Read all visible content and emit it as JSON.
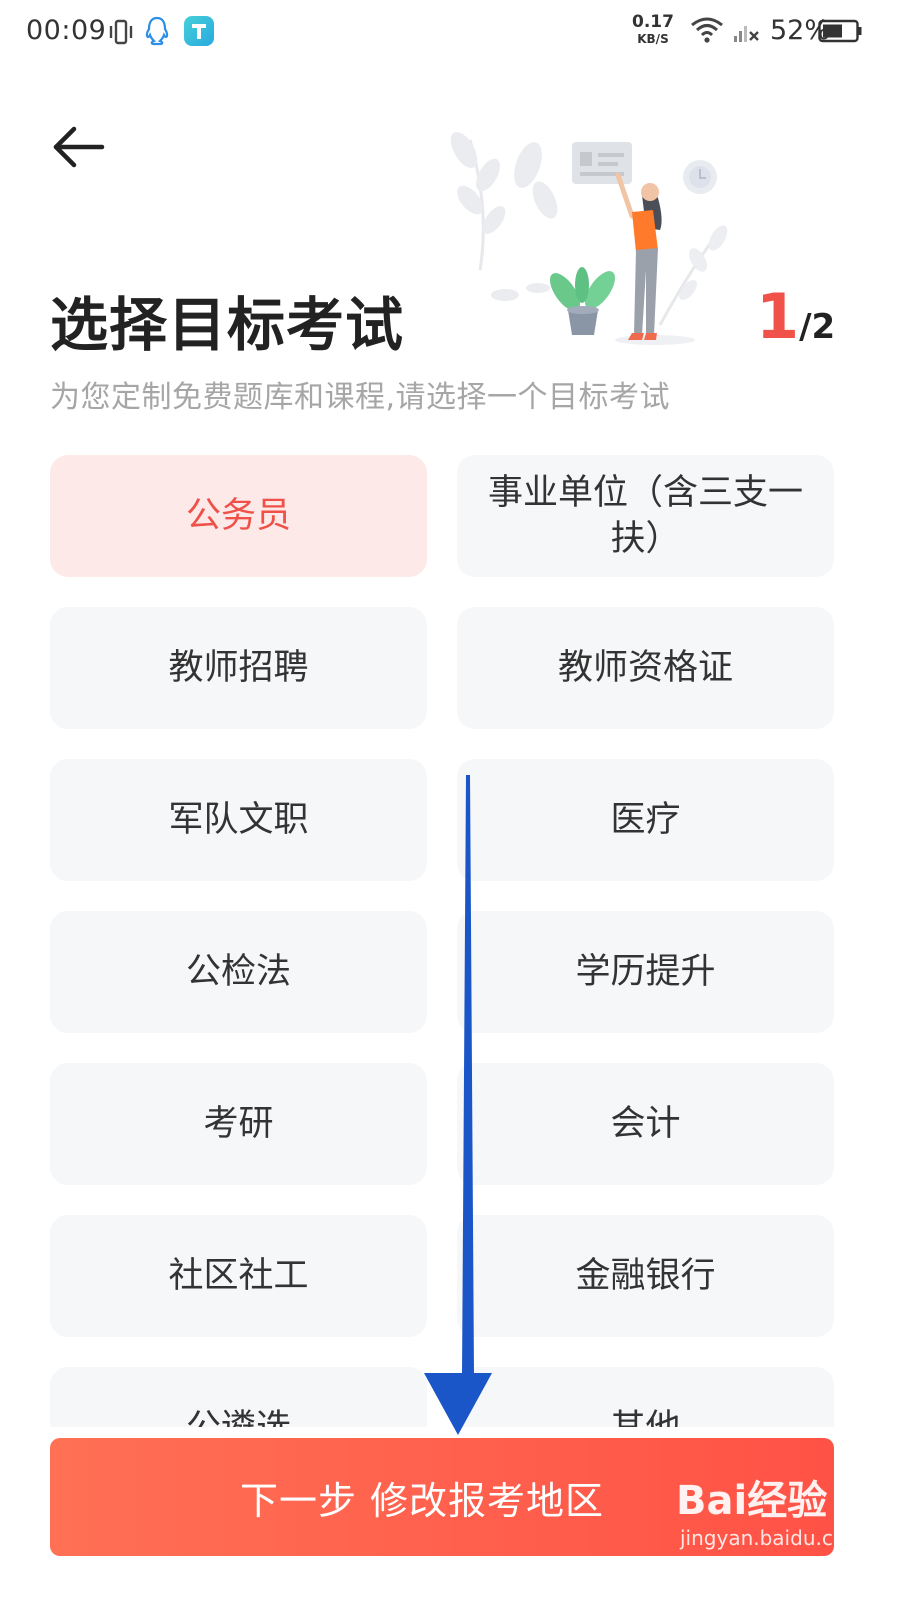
{
  "status_bar": {
    "time": "00:09",
    "net_speed_value": "0.17",
    "net_speed_unit": "KB/S",
    "battery": "52%",
    "icons": [
      "vibrate-icon",
      "qq-icon",
      "app-icon",
      "wifi-icon",
      "signal-icon",
      "battery-icon"
    ]
  },
  "header": {
    "title": "选择目标考试",
    "subtitle": "为您定制免费题库和课程,请选择一个目标考试",
    "step_current": "1",
    "step_total": "/2"
  },
  "exams": [
    {
      "label": "公务员",
      "selected": true
    },
    {
      "label": "事业单位（含三支一扶）",
      "selected": false
    },
    {
      "label": "教师招聘",
      "selected": false
    },
    {
      "label": "教师资格证",
      "selected": false
    },
    {
      "label": "军队文职",
      "selected": false
    },
    {
      "label": "医疗",
      "selected": false
    },
    {
      "label": "公检法",
      "selected": false
    },
    {
      "label": "学历提升",
      "selected": false
    },
    {
      "label": "考研",
      "selected": false
    },
    {
      "label": "会计",
      "selected": false
    },
    {
      "label": "社区社工",
      "selected": false
    },
    {
      "label": "金融银行",
      "selected": false
    },
    {
      "label": "公遴选",
      "selected": false
    },
    {
      "label": "其他",
      "selected": false
    }
  ],
  "next_button": {
    "label": "下一步 修改报考地区"
  },
  "watermark": {
    "logo_text": "Bai经验",
    "url": "jingyan.baidu.com"
  },
  "colors": {
    "accent": "#f0524a",
    "selected_bg": "#fde9e8",
    "cell_bg": "#f6f7f9",
    "arrow": "#1a56c8",
    "button_start": "#ff7055",
    "button_end": "#ff5246"
  }
}
